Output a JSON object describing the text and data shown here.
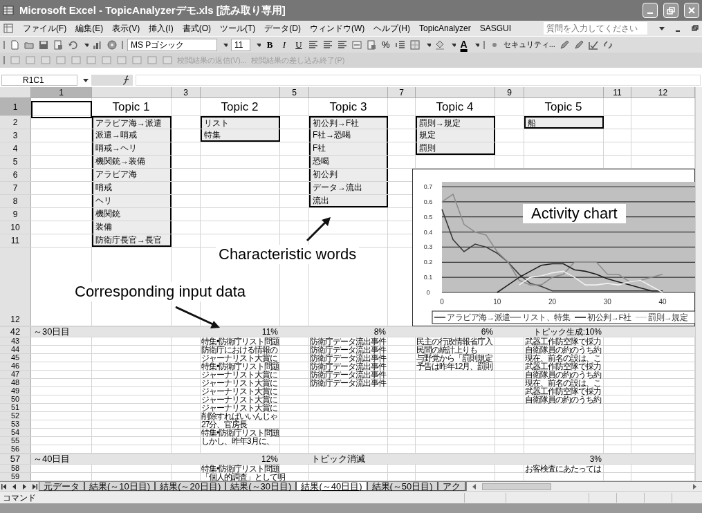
{
  "window": {
    "title": "Microsoft Excel - TopicAnalyzerデモ.xls  [読み取り専用]"
  },
  "menu": [
    "ファイル(F)",
    "編集(E)",
    "表示(V)",
    "挿入(I)",
    "書式(O)",
    "ツール(T)",
    "データ(D)",
    "ウィンドウ(W)",
    "ヘルプ(H)",
    "TopicAnalyzer",
    "SASGUI"
  ],
  "help_field": {
    "placeholder": "質問を入力してください"
  },
  "toolbar": {
    "font": "MS Pゴシック",
    "size": "11",
    "format_buttons": [
      "B",
      "I",
      "U"
    ],
    "percent": "%",
    "font_color": "A",
    "security": "セキュリティ..."
  },
  "review_toolbar": [
    {
      "label": "校閲結果の返信(V)...",
      "disabled": true
    },
    {
      "label": "校閲結果の差し込み終了(P)",
      "disabled": true
    }
  ],
  "formula_bar": {
    "name_box": "R1C1"
  },
  "sheet": {
    "columns": [
      {
        "label": "1",
        "selected": true
      },
      {
        "selected": false
      },
      {
        "label": "3",
        "selected": false
      },
      {
        "selected": false
      },
      {
        "label": "5",
        "selected": false
      },
      {
        "selected": false
      },
      {
        "label": "7",
        "selected": false
      },
      {
        "selected": false
      },
      {
        "label": "9",
        "selected": false
      },
      {
        "selected": false
      },
      {
        "label": "11",
        "selected": false
      },
      {
        "label": "12",
        "selected": false
      }
    ],
    "upper_rows": [
      {
        "label": "1",
        "selected": true
      },
      {
        "label": "2",
        "selected": false
      },
      {
        "label": "3",
        "selected": false
      },
      {
        "label": "4",
        "selected": false
      },
      {
        "label": "5",
        "selected": false
      },
      {
        "label": "6",
        "selected": false
      },
      {
        "label": "7",
        "selected": false
      },
      {
        "label": "8",
        "selected": false
      },
      {
        "label": "9",
        "selected": false
      },
      {
        "label": "10",
        "selected": false
      },
      {
        "label": "11",
        "selected": false
      },
      {
        "label": "12",
        "selected": false
      }
    ],
    "topics": [
      {
        "label": "Topic 1",
        "words": [
          "アラビア海→派遣",
          "派遣→哨戒",
          "哨戒→ヘリ",
          "機関銃→装備",
          "アラビア海",
          "哨戒",
          "ヘリ",
          "機関銃",
          "装備",
          "防衛庁長官→長官"
        ]
      },
      {
        "label": "Topic 2",
        "words": [
          "リスト",
          "特集"
        ]
      },
      {
        "label": "Topic 3",
        "words": [
          "初公判→F社",
          "F社→恐喝",
          "F社",
          "恐喝",
          "初公判",
          "データ→流出",
          "流出"
        ]
      },
      {
        "label": "Topic 4",
        "words": [
          "罰則→規定",
          "規定",
          "罰則"
        ]
      },
      {
        "label": "Topic 5",
        "words": [
          "船"
        ]
      }
    ],
    "annotations": [
      {
        "text": "Characteristic words"
      },
      {
        "text": "Corresponding input data"
      }
    ],
    "lower_rows": [
      {
        "row": "42",
        "kind": "summary",
        "label": "～30日目",
        "column_4": "11%",
        "column_6": "8%",
        "column_8": "6%",
        "column_10": "トピック生成:10%"
      },
      {
        "row": "43",
        "kind": "detail",
        "column_4": "特集•防衛庁リスト問題",
        "column_6": "防衛庁データ流出事件",
        "column_8": "民主の行政情報省庁入",
        "column_10": "武器工作防空隊で採力"
      },
      {
        "row": "44",
        "kind": "detail",
        "column_4": "防衛庁における情報の",
        "column_6": "防衛庁データ流出事件",
        "column_8": "民間の統計上りも",
        "column_10": "自衛隊員の約のうち約"
      },
      {
        "row": "45",
        "kind": "detail",
        "column_4": "ジャーナリスト大賞に",
        "column_6": "防衛庁データ流出事件",
        "column_8": "与野党から「罰則規定",
        "column_10": "現在、前名の設は、こ"
      },
      {
        "row": "46",
        "kind": "detail",
        "column_4": "特集•防衛庁リスト問題",
        "column_6": "防衛庁データ流出事件",
        "column_8": "予告は昨年12月、罰則",
        "column_10": "武器工作防空隊で採力"
      },
      {
        "row": "47",
        "kind": "detail",
        "column_4": "ジャーナリスト大賞に",
        "column_6": "防衛庁データ流出事件",
        "column_10": "自衛隊員の約のうち約"
      },
      {
        "row": "48",
        "kind": "detail",
        "column_4": "ジャーナリスト大賞に",
        "column_6": "防衛庁データ流出事件",
        "column_10": "現在、前名の設は、こ"
      },
      {
        "row": "49",
        "kind": "detail",
        "column_4": "ジャーナリスト大賞に",
        "column_10": "武器工作防空隊で採力"
      },
      {
        "row": "50",
        "kind": "detail",
        "column_4": "ジャーナリスト大賞に",
        "column_10": "自衛隊員の約のうち約"
      },
      {
        "row": "51",
        "kind": "detail",
        "column_4": "ジャーナリスト大賞に"
      },
      {
        "row": "52",
        "kind": "detail",
        "column_4": "削除すればいいんじゃ"
      },
      {
        "row": "53",
        "kind": "detail",
        "column_4": "27分、官房長"
      },
      {
        "row": "54",
        "kind": "detail",
        "column_4": "特集•防衛庁リスト問題"
      },
      {
        "row": "55",
        "kind": "detail",
        "column_4": "しかし、昨年3月に、"
      },
      {
        "row": "56",
        "kind": "detail"
      },
      {
        "row": "57",
        "kind": "summary",
        "label": "～40日目",
        "column_4": "12%",
        "note": "トピック消滅",
        "column_10": "3%"
      },
      {
        "row": "58",
        "kind": "detail",
        "column_4": "特集•防衛庁リスト問題",
        "column_10": "お客検査にあたっては"
      },
      {
        "row": "59",
        "kind": "detail",
        "column_4": "「個人的調査」として明"
      }
    ]
  },
  "chart": {
    "chart_data": {
      "type": "line",
      "title": "Activity chart",
      "grid": true,
      "legend": true,
      "x": [
        0,
        2,
        4,
        6,
        8,
        10,
        12,
        14,
        16,
        18,
        20,
        22,
        24,
        26,
        28,
        30,
        32,
        34,
        36,
        38,
        40
      ],
      "xlim": [
        0,
        46
      ],
      "ylim": [
        0,
        0.7
      ],
      "xticks": [
        0,
        10,
        20,
        30,
        40
      ],
      "yticks": [
        0,
        0.1,
        0.2,
        0.3,
        0.4,
        0.5,
        0.6,
        0.7
      ],
      "series": [
        {
          "name": "アラビア海→派遣",
          "color": "#3a3a3a",
          "values": [
            0.55,
            0.35,
            0.27,
            0.32,
            0.3,
            0.26,
            0.2,
            0.12,
            0.06,
            0.04,
            0.01,
            0.01,
            0.01,
            0.01,
            0.01,
            0.01,
            0.01,
            0.01,
            0.01,
            0.01,
            0.01
          ]
        },
        {
          "name": "リスト、特集",
          "color": "#8c8c8c",
          "values": [
            0.6,
            0.65,
            0.45,
            0.4,
            0.38,
            0.27,
            0.2,
            0.08,
            0.05,
            0.05,
            0.1,
            0.12,
            0.2,
            0.2,
            0.2,
            0.12,
            0.12,
            0.07,
            0.08,
            0.1,
            0.12
          ]
        },
        {
          "name": "初公判→F社",
          "color": "#1e1e1e",
          "values": [
            null,
            null,
            null,
            null,
            null,
            0,
            0.05,
            0.1,
            0.14,
            0.18,
            0.19,
            0.19,
            0.15,
            0.14,
            0.12,
            0.09,
            0.07,
            0.05,
            0.03,
            0.01,
            0.01
          ]
        },
        {
          "name": "罰則→規定",
          "color": "#f0f0f0",
          "values": [
            null,
            null,
            null,
            null,
            null,
            null,
            null,
            0.05,
            0.1,
            0.11,
            0.13,
            0.14,
            0.1,
            0.05,
            0.05,
            0.06,
            0.05,
            0.07,
            0.08,
            0.04,
            0
          ]
        }
      ]
    }
  },
  "sheet_tabs": [
    {
      "label": "元データ",
      "selected": false
    },
    {
      "label": "結果(～10日目)",
      "selected": false
    },
    {
      "label": "結果(～20日目)",
      "selected": false
    },
    {
      "label": "結果(～30日目)",
      "selected": false
    },
    {
      "label": "結果(～40日目)",
      "selected": true
    },
    {
      "label": "結果(～50日目)",
      "selected": false
    },
    {
      "label": "アク",
      "selected": false
    }
  ],
  "status_bar": {
    "text": "コマンド"
  }
}
